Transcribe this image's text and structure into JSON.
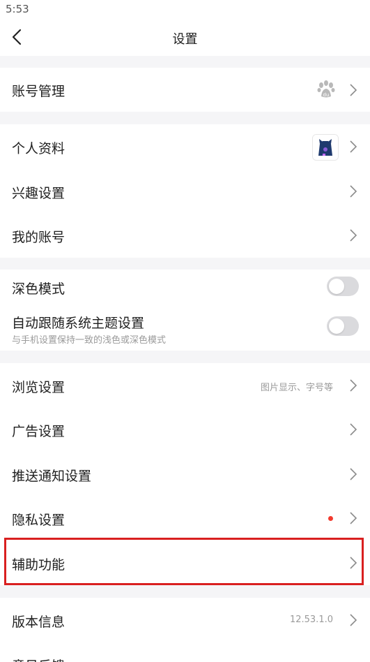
{
  "status_bar": {
    "time": "5:53"
  },
  "header": {
    "title": "设置"
  },
  "rows": {
    "account_management": {
      "label": "账号管理"
    },
    "profile": {
      "label": "个人资料"
    },
    "interests": {
      "label": "兴趣设置"
    },
    "my_account": {
      "label": "我的账号"
    },
    "dark_mode": {
      "label": "深色模式",
      "enabled": false
    },
    "auto_theme": {
      "label": "自动跟随系统主题设置",
      "sublabel": "与手机设置保持一致的浅色或深色模式",
      "enabled": false
    },
    "browse": {
      "label": "浏览设置",
      "value": "图片显示、字号等"
    },
    "ads": {
      "label": "广告设置"
    },
    "push": {
      "label": "推送通知设置"
    },
    "privacy": {
      "label": "隐私设置",
      "badge_color": "#f23a2e"
    },
    "accessibility": {
      "label": "辅助功能"
    },
    "version": {
      "label": "版本信息",
      "value": "12.53.1.0"
    },
    "feedback": {
      "label": "意见反馈"
    }
  },
  "colors": {
    "highlight": "#d92020",
    "background": "#f5f5f7"
  }
}
